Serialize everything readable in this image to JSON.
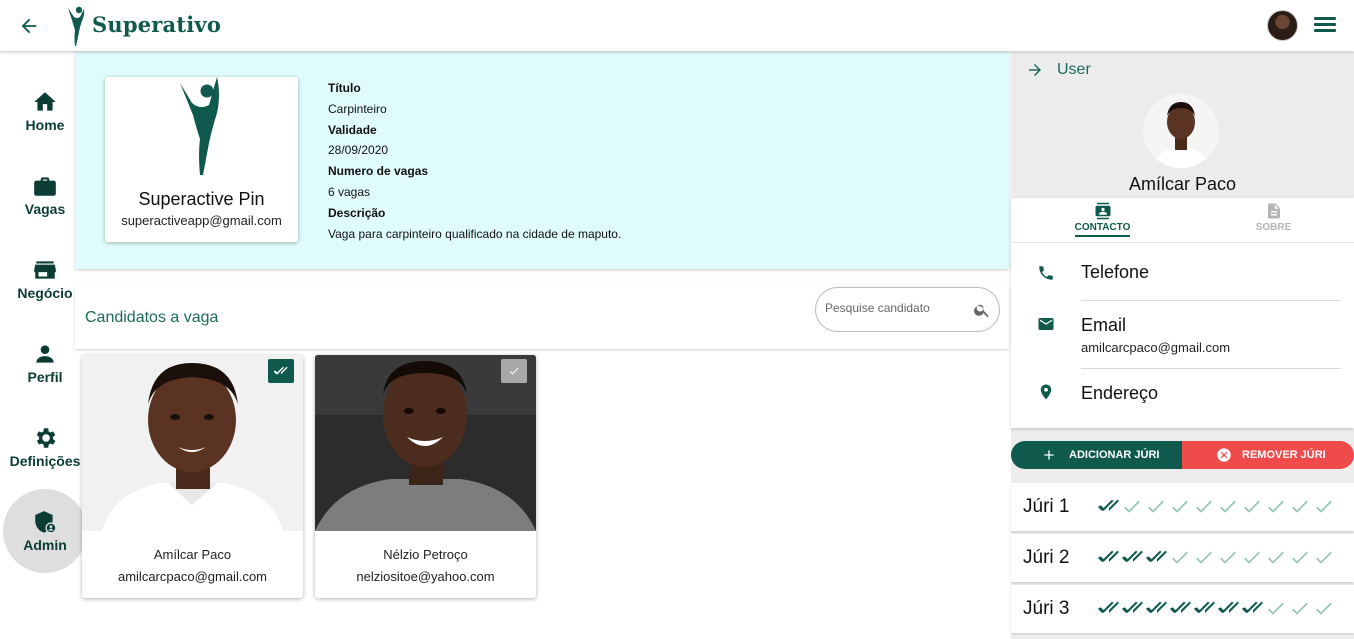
{
  "app": {
    "brand": "Superativo",
    "colors": {
      "primary": "#0f5a4c",
      "job_panel_bg": "#dffbfb",
      "danger": "#ef4b4b",
      "checked_dark": "#0f5a4c",
      "checked_light": "#9bc7bd"
    }
  },
  "topbar": {
    "back_icon": "arrow-left-icon",
    "menu_icon": "hamburger-menu-icon"
  },
  "sidebar": {
    "items": [
      {
        "label": "Home",
        "icon": "home-icon"
      },
      {
        "label": "Vagas",
        "icon": "briefcase-icon"
      },
      {
        "label": "Negócio",
        "icon": "store-icon"
      },
      {
        "label": "Perfil",
        "icon": "person-icon"
      },
      {
        "label": "Definições",
        "icon": "gear-icon"
      },
      {
        "label": "Admin",
        "icon": "admin-shield-icon",
        "active": true
      }
    ]
  },
  "job": {
    "company_name": "Superactive Pin",
    "company_email": "superactiveapp@gmail.com",
    "fields": [
      {
        "label": "Título",
        "value": "Carpinteiro"
      },
      {
        "label": "Validade",
        "value": "28/09/2020"
      },
      {
        "label": "Numero de vagas",
        "value": "6 vagas"
      },
      {
        "label": "Descrição",
        "value": "Vaga para carpinteiro qualificado na cidade de maputo."
      }
    ]
  },
  "candidates": {
    "title": "Candidatos a vaga",
    "search_placeholder": "Pesquise candidato",
    "items": [
      {
        "name": "Amílcar Paco",
        "email": "amilcarcpaco@gmail.com",
        "selected": true
      },
      {
        "name": "Nélzio Petroço",
        "email": "nelziositoe@yahoo.com",
        "selected": false
      }
    ]
  },
  "user_panel": {
    "header": "User",
    "name": "Amílcar Paco",
    "tabs": [
      {
        "label": "CONTACTO",
        "icon": "contact-card-icon",
        "active": true
      },
      {
        "label": "SOBRE",
        "icon": "document-icon",
        "active": false
      }
    ],
    "contact": {
      "phone_label": "Telefone",
      "email_label": "Email",
      "email_value": "amilcarcpaco@gmail.com",
      "address_label": "Endereço"
    },
    "add_jury_label": "ADICIONAR JÚRI",
    "remove_jury_label": "REMOVER JÚRI",
    "juries": [
      {
        "label": "Júri 1",
        "checked": 1,
        "total": 10
      },
      {
        "label": "Júri 2",
        "checked": 3,
        "total": 10
      },
      {
        "label": "Júri 3",
        "checked": 7,
        "total": 10
      }
    ]
  }
}
